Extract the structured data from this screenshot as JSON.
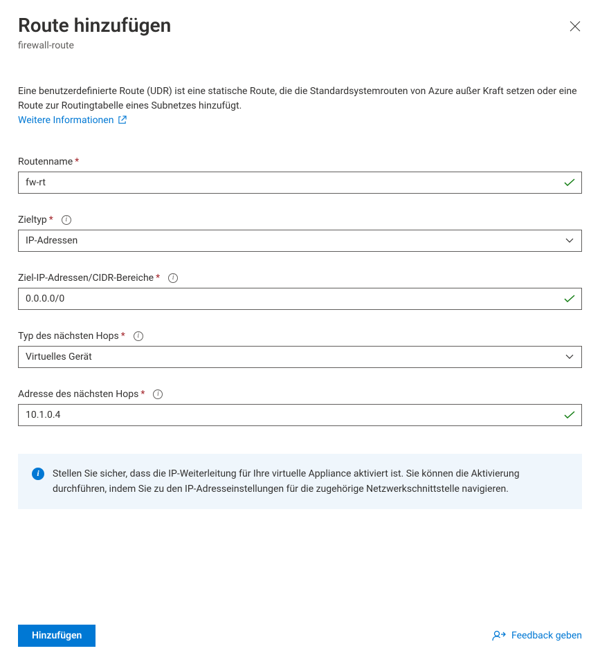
{
  "header": {
    "title": "Route hinzufügen",
    "subtitle": "firewall-route"
  },
  "intro": {
    "description": "Eine benutzerdefinierte Route (UDR) ist eine statische Route, die die Standardsystemrouten von Azure außer Kraft setzen oder eine Route zur Routingtabelle eines Subnetzes hinzufügt.",
    "learnMore": "Weitere Informationen"
  },
  "fields": {
    "routeName": {
      "label": "Routenname",
      "value": "fw-rt"
    },
    "destType": {
      "label": "Zieltyp",
      "value": "IP-Adressen"
    },
    "destCidr": {
      "label": "Ziel-IP-Adressen/CIDR-Bereiche",
      "value": "0.0.0.0/0"
    },
    "nextHopType": {
      "label": "Typ des nächsten Hops",
      "value": "Virtuelles Gerät"
    },
    "nextHopAddr": {
      "label": "Adresse des nächsten Hops",
      "value": "10.1.0.4"
    }
  },
  "infoBox": {
    "text": "Stellen Sie sicher, dass die IP-Weiterleitung für Ihre virtuelle Appliance aktiviert ist. Sie können die Aktivierung durchführen, indem Sie zu den IP-Adresseinstellungen für die zugehörige Netzwerkschnittstelle navigieren."
  },
  "footer": {
    "addButton": "Hinzufügen",
    "feedback": "Feedback geben"
  }
}
